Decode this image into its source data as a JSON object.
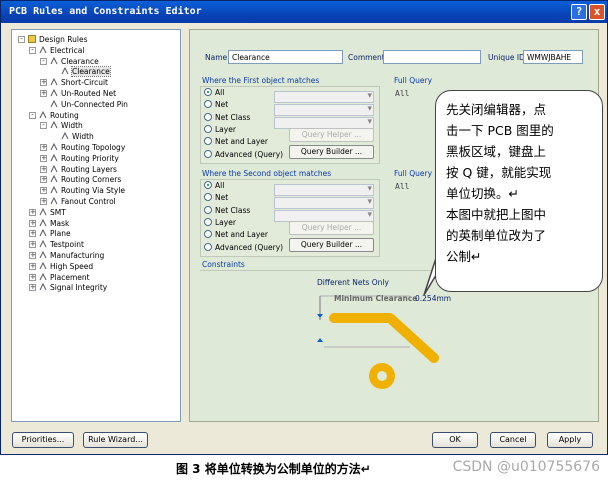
{
  "window": {
    "title": "PCB Rules and Constraints Editor",
    "help_icon": "?",
    "close_icon": "x"
  },
  "tree": {
    "items": [
      {
        "label": "Design Rules",
        "indent": 0,
        "exp": "-",
        "icon": "folder-icon"
      },
      {
        "label": "Electrical",
        "indent": 1,
        "exp": "-",
        "icon": "rule-icon"
      },
      {
        "label": "Clearance",
        "indent": 2,
        "exp": "-",
        "icon": "rule-icon"
      },
      {
        "label": "Clearance",
        "indent": 3,
        "exp": "",
        "icon": "rule-icon",
        "selected": true
      },
      {
        "label": "Short-Circuit",
        "indent": 2,
        "exp": "+",
        "icon": "rule-icon"
      },
      {
        "label": "Un-Routed Net",
        "indent": 2,
        "exp": "+",
        "icon": "rule-icon"
      },
      {
        "label": "Un-Connected Pin",
        "indent": 2,
        "exp": "",
        "icon": "rule-icon"
      },
      {
        "label": "Routing",
        "indent": 1,
        "exp": "-",
        "icon": "rule-icon"
      },
      {
        "label": "Width",
        "indent": 2,
        "exp": "-",
        "icon": "rule-icon"
      },
      {
        "label": "Width",
        "indent": 3,
        "exp": "",
        "icon": "rule-icon"
      },
      {
        "label": "Routing Topology",
        "indent": 2,
        "exp": "+",
        "icon": "rule-icon"
      },
      {
        "label": "Routing Priority",
        "indent": 2,
        "exp": "+",
        "icon": "rule-icon"
      },
      {
        "label": "Routing Layers",
        "indent": 2,
        "exp": "+",
        "icon": "rule-icon"
      },
      {
        "label": "Routing Corners",
        "indent": 2,
        "exp": "+",
        "icon": "rule-icon"
      },
      {
        "label": "Routing Via Style",
        "indent": 2,
        "exp": "+",
        "icon": "rule-icon"
      },
      {
        "label": "Fanout Control",
        "indent": 2,
        "exp": "+",
        "icon": "rule-icon"
      },
      {
        "label": "SMT",
        "indent": 1,
        "exp": "+",
        "icon": "rule-icon"
      },
      {
        "label": "Mask",
        "indent": 1,
        "exp": "+",
        "icon": "rule-icon"
      },
      {
        "label": "Plane",
        "indent": 1,
        "exp": "+",
        "icon": "rule-icon"
      },
      {
        "label": "Testpoint",
        "indent": 1,
        "exp": "+",
        "icon": "rule-icon"
      },
      {
        "label": "Manufacturing",
        "indent": 1,
        "exp": "+",
        "icon": "rule-icon"
      },
      {
        "label": "High Speed",
        "indent": 1,
        "exp": "+",
        "icon": "rule-icon"
      },
      {
        "label": "Placement",
        "indent": 1,
        "exp": "+",
        "icon": "rule-icon"
      },
      {
        "label": "Signal Integrity",
        "indent": 1,
        "exp": "+",
        "icon": "rule-icon"
      }
    ]
  },
  "rule": {
    "name_label": "Name",
    "name_value": "Clearance",
    "comment_label": "Comment",
    "comment_value": "",
    "uid_label": "Unique ID",
    "uid_value": "WMWJBAHE"
  },
  "first_match": {
    "title": "Where the First object matches",
    "options": [
      "All",
      "Net",
      "Net Class",
      "Layer",
      "Net and Layer",
      "Advanced (Query)"
    ],
    "selected": "All",
    "query_helper": "Query Helper ...",
    "query_builder": "Query Builder ...",
    "full_query_label": "Full Query",
    "full_query_value": "All"
  },
  "second_match": {
    "title": "Where the Second object matches",
    "options": [
      "All",
      "Net",
      "Net Class",
      "Layer",
      "Net and Layer",
      "Advanced (Query)"
    ],
    "selected": "All",
    "query_helper": "Query Helper ...",
    "query_builder": "Query Builder ...",
    "full_query_label": "Full Query",
    "full_query_value": "All"
  },
  "constraints": {
    "title": "Constraints",
    "mode": "Different Nets Only",
    "min_clearance_label": "Minimum Clearance",
    "min_clearance_value": "0.254mm"
  },
  "footer": {
    "priorities": "Priorities...",
    "rule_wizard": "Rule Wizard...",
    "ok": "OK",
    "cancel": "Cancel",
    "apply": "Apply"
  },
  "annotation": {
    "lines": [
      "先关闭编辑器，点",
      "击一下 PCB 图里的",
      "黑板区域，键盘上",
      "按 Q 键，就能实现",
      "单位切换。↵",
      "本图中就把上图中",
      "的英制单位改为了",
      "公制↵"
    ]
  },
  "caption": "图 3 将单位转换为公制单位的方法↵",
  "watermark": "CSDN @u010755676",
  "colors": {
    "title_bar": "#0a5fd8",
    "panel_bg": "#dfe9d8",
    "track": "#f0b000"
  }
}
